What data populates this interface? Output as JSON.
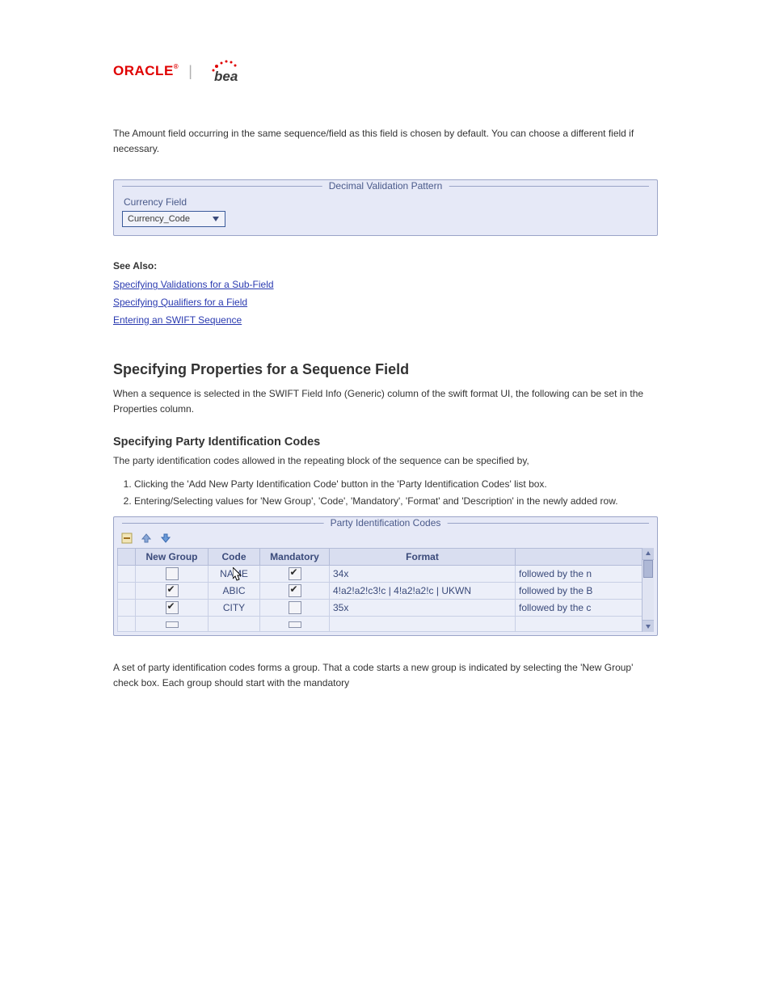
{
  "intro_paragraph": "The Amount field occurring in the same sequence/field as this field is chosen by default. You can choose a different field if necessary.",
  "decimal_panel": {
    "title": "Decimal Validation Pattern",
    "field_label": "Currency Field",
    "selected": "Currency_Code"
  },
  "see_also_label": "See Also:",
  "see_also_links": [
    "Specifying Validations for a Sub-Field",
    "Specifying Qualifiers for a Field",
    "Entering an SWIFT Sequence"
  ],
  "section_heading": "Specifying Properties for a Sequence Field",
  "properties_intro": "When a sequence is selected in the SWIFT Field Info (Generic) column of the swift format UI, the following can be set in the Properties column.",
  "party_heading": "Specifying Party Identification Codes",
  "party_intro": "The party identification codes allowed in the repeating block of the sequence can be specified by,",
  "party_steps": [
    "Clicking the 'Add New Party Identification Code' button in the 'Party Identification Codes' list box.",
    "Entering/Selecting values for 'New Group', 'Code', 'Mandatory', 'Format' and 'Description' in the newly added row."
  ],
  "pic_panel": {
    "title": "Party Identification Codes",
    "toolbar": {
      "remove": "remove-row",
      "up": "move-up",
      "down": "move-down"
    },
    "columns": [
      "",
      "New Group",
      "Code",
      "Mandatory",
      "Format",
      ""
    ],
    "rows": [
      {
        "new_group": false,
        "code": "NAME",
        "mandatory": true,
        "format": "34x",
        "desc": "followed by the n"
      },
      {
        "new_group": true,
        "code": "ABIC",
        "mandatory": true,
        "format": "4!a2!a2!c3!c | 4!a2!a2!c | UKWN",
        "desc": "followed by the B"
      },
      {
        "new_group": true,
        "code": "CITY",
        "mandatory": false,
        "format": "35x",
        "desc": "followed by the c"
      },
      {
        "new_group": false,
        "code": "",
        "mandatory": false,
        "format": "",
        "desc": ""
      }
    ]
  },
  "footer": "A set of party identification codes forms a group. That a code starts a new group is indicated by selecting the 'New Group' check box. Each group should start with the mandatory"
}
